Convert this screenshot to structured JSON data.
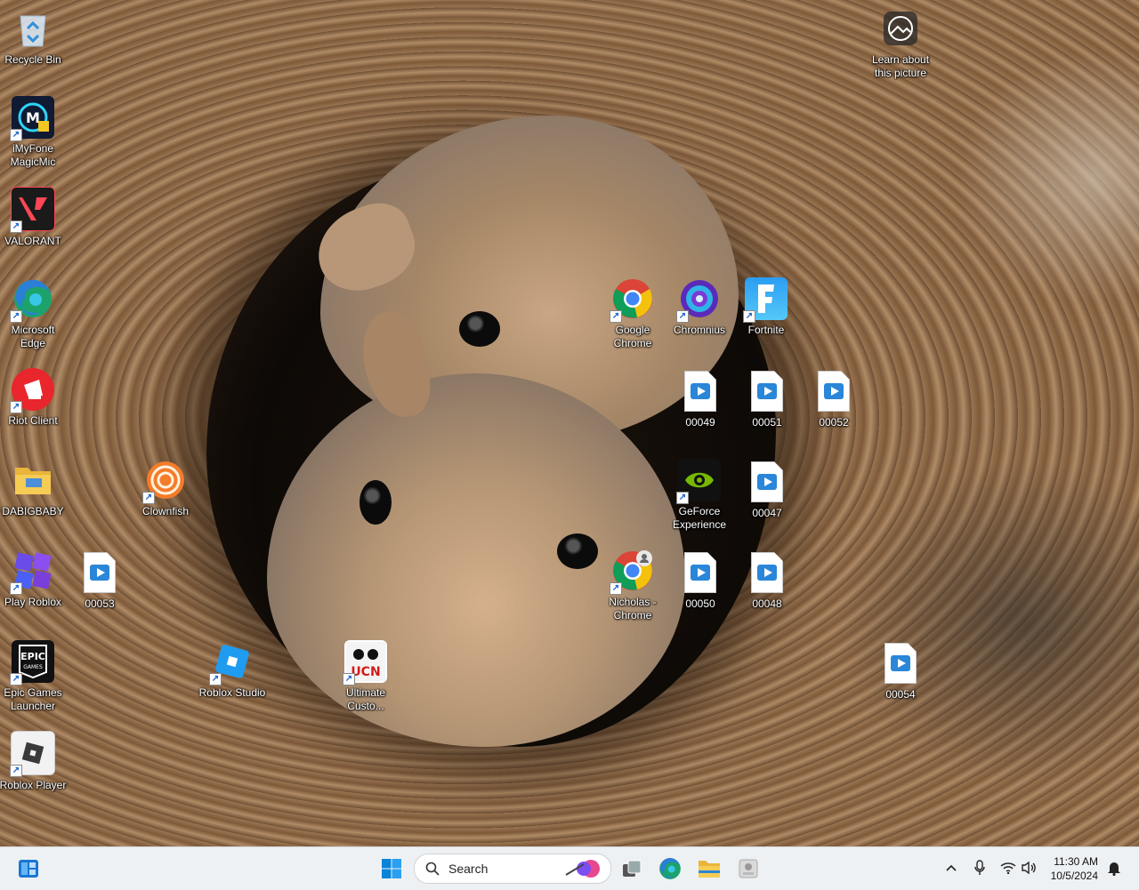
{
  "desktop": {
    "icons": [
      {
        "label": "Recycle Bin",
        "icon": "recycle-bin-icon"
      },
      {
        "label": "iMyFone MagicMic",
        "icon": "magicmic-icon"
      },
      {
        "label": "VALORANT",
        "icon": "valorant-icon"
      },
      {
        "label": "Microsoft Edge",
        "icon": "edge-icon"
      },
      {
        "label": "Riot Client",
        "icon": "riot-client-icon"
      },
      {
        "label": "DABIGBABY",
        "icon": "folder-icon"
      },
      {
        "label": "Play Roblox",
        "icon": "play-roblox-icon"
      },
      {
        "label": "00053",
        "icon": "video-file-icon"
      },
      {
        "label": "Epic Games Launcher",
        "icon": "epic-games-icon"
      },
      {
        "label": "Roblox Player",
        "icon": "roblox-player-icon"
      },
      {
        "label": "Clownfish",
        "icon": "clownfish-icon"
      },
      {
        "label": "Roblox Studio",
        "icon": "roblox-studio-icon"
      },
      {
        "label": "Ultimate Custo...",
        "icon": "ultimate-custom-night-icon"
      },
      {
        "label": "Google Chrome",
        "icon": "chrome-icon"
      },
      {
        "label": "Chromnius",
        "icon": "chromnius-icon"
      },
      {
        "label": "Fortnite",
        "icon": "fortnite-icon"
      },
      {
        "label": "00049",
        "icon": "video-file-icon"
      },
      {
        "label": "00051",
        "icon": "video-file-icon"
      },
      {
        "label": "00052",
        "icon": "video-file-icon"
      },
      {
        "label": "GeForce Experience",
        "icon": "geforce-icon"
      },
      {
        "label": "00047",
        "icon": "video-file-icon"
      },
      {
        "label": "Nicholas - Chrome",
        "icon": "chrome-profile-icon"
      },
      {
        "label": "00050",
        "icon": "video-file-icon"
      },
      {
        "label": "00048",
        "icon": "video-file-icon"
      },
      {
        "label": "00054",
        "icon": "video-file-icon"
      },
      {
        "label": "Learn about this picture",
        "icon": "learn-picture-icon"
      }
    ]
  },
  "taskbar": {
    "search_placeholder": "Search",
    "time": "11:30 AM",
    "date": "10/5/2024",
    "accent_color": "#0078d4",
    "items": [
      "widgets-icon",
      "start-icon",
      "task-view-icon",
      "edge-icon",
      "file-explorer-icon",
      "app-icon"
    ],
    "tray": [
      "chevron-up-icon",
      "microphone-icon",
      "wifi-icon",
      "volume-icon",
      "notification-bell-icon"
    ]
  }
}
